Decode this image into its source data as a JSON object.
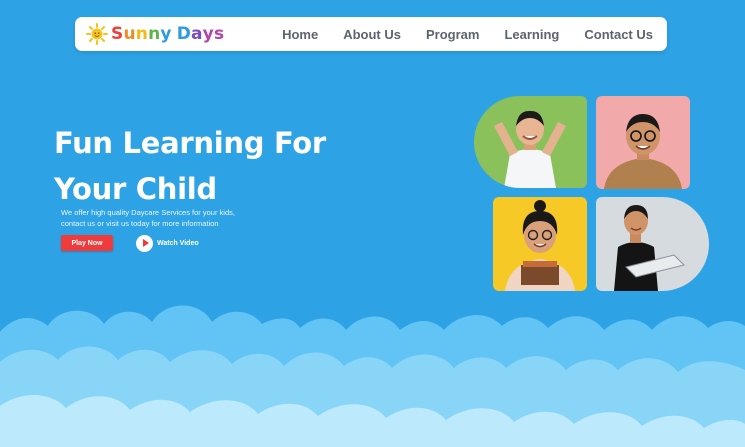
{
  "brand": {
    "letters": [
      "S",
      "u",
      "n",
      "n",
      "y",
      " ",
      "D",
      "a",
      "y",
      "s"
    ],
    "letter_colors": [
      "#e8433a",
      "#f08a24",
      "#f5b914",
      "#62b24a",
      "#2e9be0",
      "#ffffff",
      "#2e9be0",
      "#7a4bc4",
      "#b345a8",
      "#b345a8"
    ],
    "sun_color": "#f7c21b",
    "icon": "sun-icon"
  },
  "nav": {
    "items": [
      "Home",
      "About Us",
      "Program",
      "Learning",
      "Contact Us"
    ]
  },
  "hero": {
    "title_line1": "Fun Learning For",
    "title_line2": "Your Child",
    "desc_line1": "We offer high quality Daycare Services for your kids,",
    "desc_line2": "contact us or visit us today for more information",
    "play_label": "Play Now",
    "watch_label": "Watch Video",
    "watch_icon": "play-icon"
  },
  "colors": {
    "background": "#2da3e6",
    "accent_red": "#ef3b3b",
    "photo_green": "#8bc15b",
    "photo_pink": "#f2a9aa",
    "photo_yellow": "#f7c926",
    "photo_grey": "#d6dbe0"
  }
}
